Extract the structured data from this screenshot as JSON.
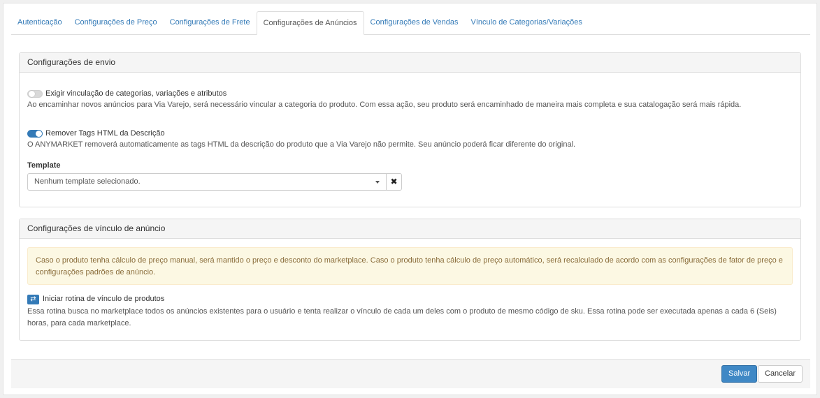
{
  "tabs": [
    {
      "label": "Autenticação"
    },
    {
      "label": "Configurações de Preço"
    },
    {
      "label": "Configurações de Frete"
    },
    {
      "label": "Configurações de Anúncios"
    },
    {
      "label": "Configurações de Vendas"
    },
    {
      "label": "Vínculo de Categorias/Variações"
    }
  ],
  "active_tab": "Configurações de Anúncios",
  "envio": {
    "title": "Configurações de envio",
    "require_toggle": {
      "label": "Exigir vinculação de categorias, variações e atributos",
      "enabled": false,
      "description": "Ao encaminhar novos anúncios para Via Varejo, será necessário vincular a categoria do produto. Com essa ação, seu produto será encaminhado de maneira mais completa e sua catalogação será mais rápida."
    },
    "html_toggle": {
      "label": "Remover Tags HTML da Descrição",
      "enabled": true,
      "description": "O ANYMARKET removerá automaticamente as tags HTML da descrição do produto que a Via Varejo não permite. Seu anúncio poderá ficar diferente do original."
    },
    "template": {
      "label": "Template",
      "value": "Nenhum template selecionado.",
      "clear_icon": "times-icon"
    }
  },
  "vinculo": {
    "title": "Configurações de vínculo de anúncio",
    "alert": "Caso o produto tenha cálculo de preço manual, será mantido o preço e desconto do marketplace. Caso o produto tenha cálculo de preço automático, será recalculado de acordo com as configurações de fator de preço e configurações padrões de anúncio.",
    "routine_icon": "exchange-icon",
    "routine_label": "Iniciar rotina de vínculo de produtos",
    "routine_description": "Essa rotina busca no marketplace todos os anúncios existentes para o usuário e tenta realizar o vínculo de cada um deles com o produto de mesmo código de sku. Essa rotina pode ser executada apenas a cada 6 (Seis) horas, para cada marketplace."
  },
  "footer": {
    "save_label": "Salvar",
    "cancel_label": "Cancelar"
  },
  "colors": {
    "primary": "#337ab7",
    "alert_bg": "#fcf8e3",
    "alert_text": "#8a6d3b"
  }
}
